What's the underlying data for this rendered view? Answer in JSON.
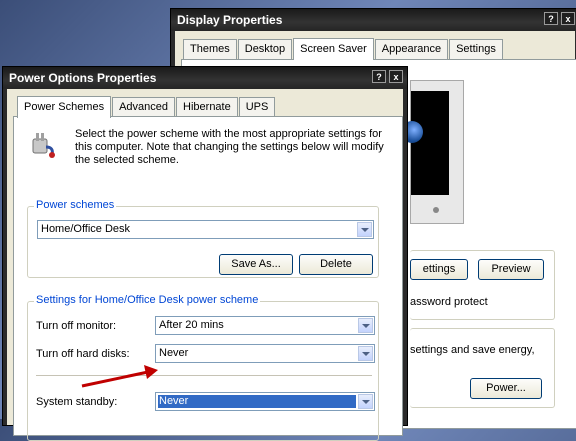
{
  "display_window": {
    "title": "Display Properties",
    "tabs": [
      "Themes",
      "Desktop",
      "Screen Saver",
      "Appearance",
      "Settings"
    ],
    "settings_button": "ettings",
    "preview_button": "Preview",
    "password_text": "assword protect",
    "energy_text": "settings and save energy,",
    "power_button": "Power..."
  },
  "power_window": {
    "title": "Power Options Properties",
    "tabs": [
      "Power Schemes",
      "Advanced",
      "Hibernate",
      "UPS"
    ],
    "description": "Select the power scheme with the most appropriate settings for this computer. Note that changing the settings below will modify the selected scheme.",
    "schemes_group": "Power schemes",
    "scheme_value": "Home/Office Desk",
    "save_as": "Save As...",
    "delete": "Delete",
    "settings_group": "Settings for Home/Office Desk power scheme",
    "monitor_label": "Turn off monitor:",
    "monitor_value": "After 20 mins",
    "disks_label": "Turn off hard disks:",
    "disks_value": "Never",
    "standby_label": "System standby:",
    "standby_value": "Never"
  },
  "title_buttons": {
    "help": "?",
    "close": "x"
  },
  "colors": {
    "selection": "#316ac5",
    "arrow": "#c00000",
    "legend": "#0046d5"
  },
  "icons": [
    "help-icon",
    "close-icon",
    "power-plug-icon",
    "dropdown-arrow-icon",
    "annotation-arrow-icon"
  ]
}
